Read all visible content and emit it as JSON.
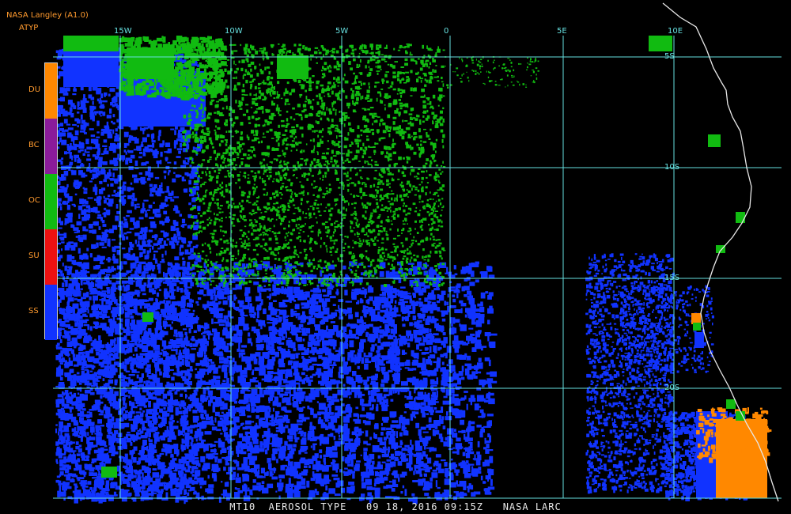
{
  "header": {
    "source": "NASA Langley (A1.0)",
    "product": "ATYP"
  },
  "legend": [
    {
      "code": "DU",
      "color": "#ff8800"
    },
    {
      "code": "BC",
      "color": "#8a1b9a"
    },
    {
      "code": "OC",
      "color": "#11bb11"
    },
    {
      "code": "SU",
      "color": "#ee1111"
    },
    {
      "code": "SS",
      "color": "#1133ff"
    }
  ],
  "grid": {
    "lon_labels": [
      "15W",
      "10W",
      "5W",
      "0",
      "5E",
      "10E"
    ],
    "lat_labels": [
      "5S",
      "10S",
      "15S",
      "20S"
    ],
    "color": "#66e0e0"
  },
  "footer": "MT10  AEROSOL TYPE   09 18, 2016 09:15Z   NASA LARC"
}
